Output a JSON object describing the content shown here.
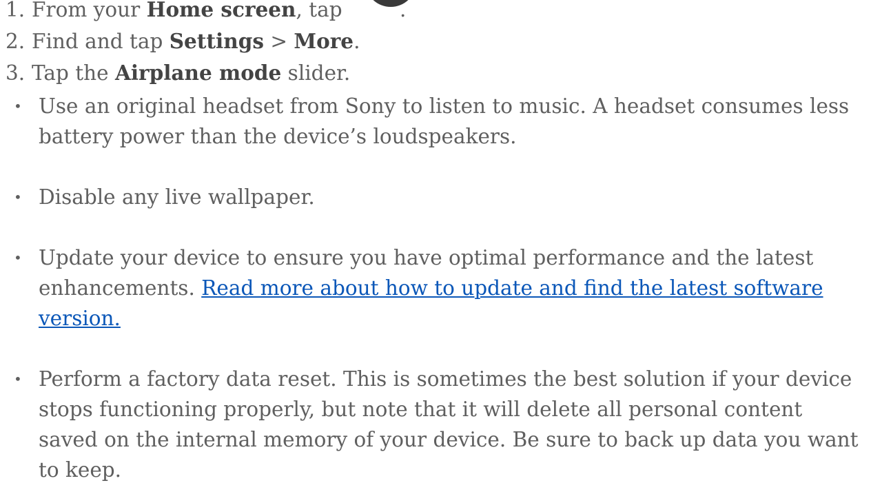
{
  "steps": [
    {
      "number": "1.",
      "pre": "From your ",
      "bold": "Home screen",
      "post": ", tap ",
      "tail": "."
    },
    {
      "number": "2.",
      "pre": "Find and tap ",
      "bold1": "Settings",
      "sep": " > ",
      "bold2": "More",
      "post": "."
    },
    {
      "number": "3.",
      "pre": "Tap the ",
      "bold": "Airplane mode",
      "post": " slider."
    }
  ],
  "icons": {
    "home_apps": "apps-icon"
  },
  "bullets": [
    {
      "text": "Use an original headset from Sony to listen to music. A headset consumes less battery power than the device’s loudspeakers."
    },
    {
      "text": "Disable any live wallpaper."
    },
    {
      "text": "Update your device to ensure you have optimal performance and the latest enhancements. ",
      "link": "Read more about how to update and find the latest software version."
    },
    {
      "text": "Perform a factory data reset. This is sometimes the best solution if your device stops functioning properly, but note that it will delete all personal content saved on the internal memory of your device. Be sure to back up data you want to keep."
    }
  ],
  "colors": {
    "text": "#5f5f5f",
    "link": "#0b57b8",
    "icon": "#3a3a3a"
  }
}
